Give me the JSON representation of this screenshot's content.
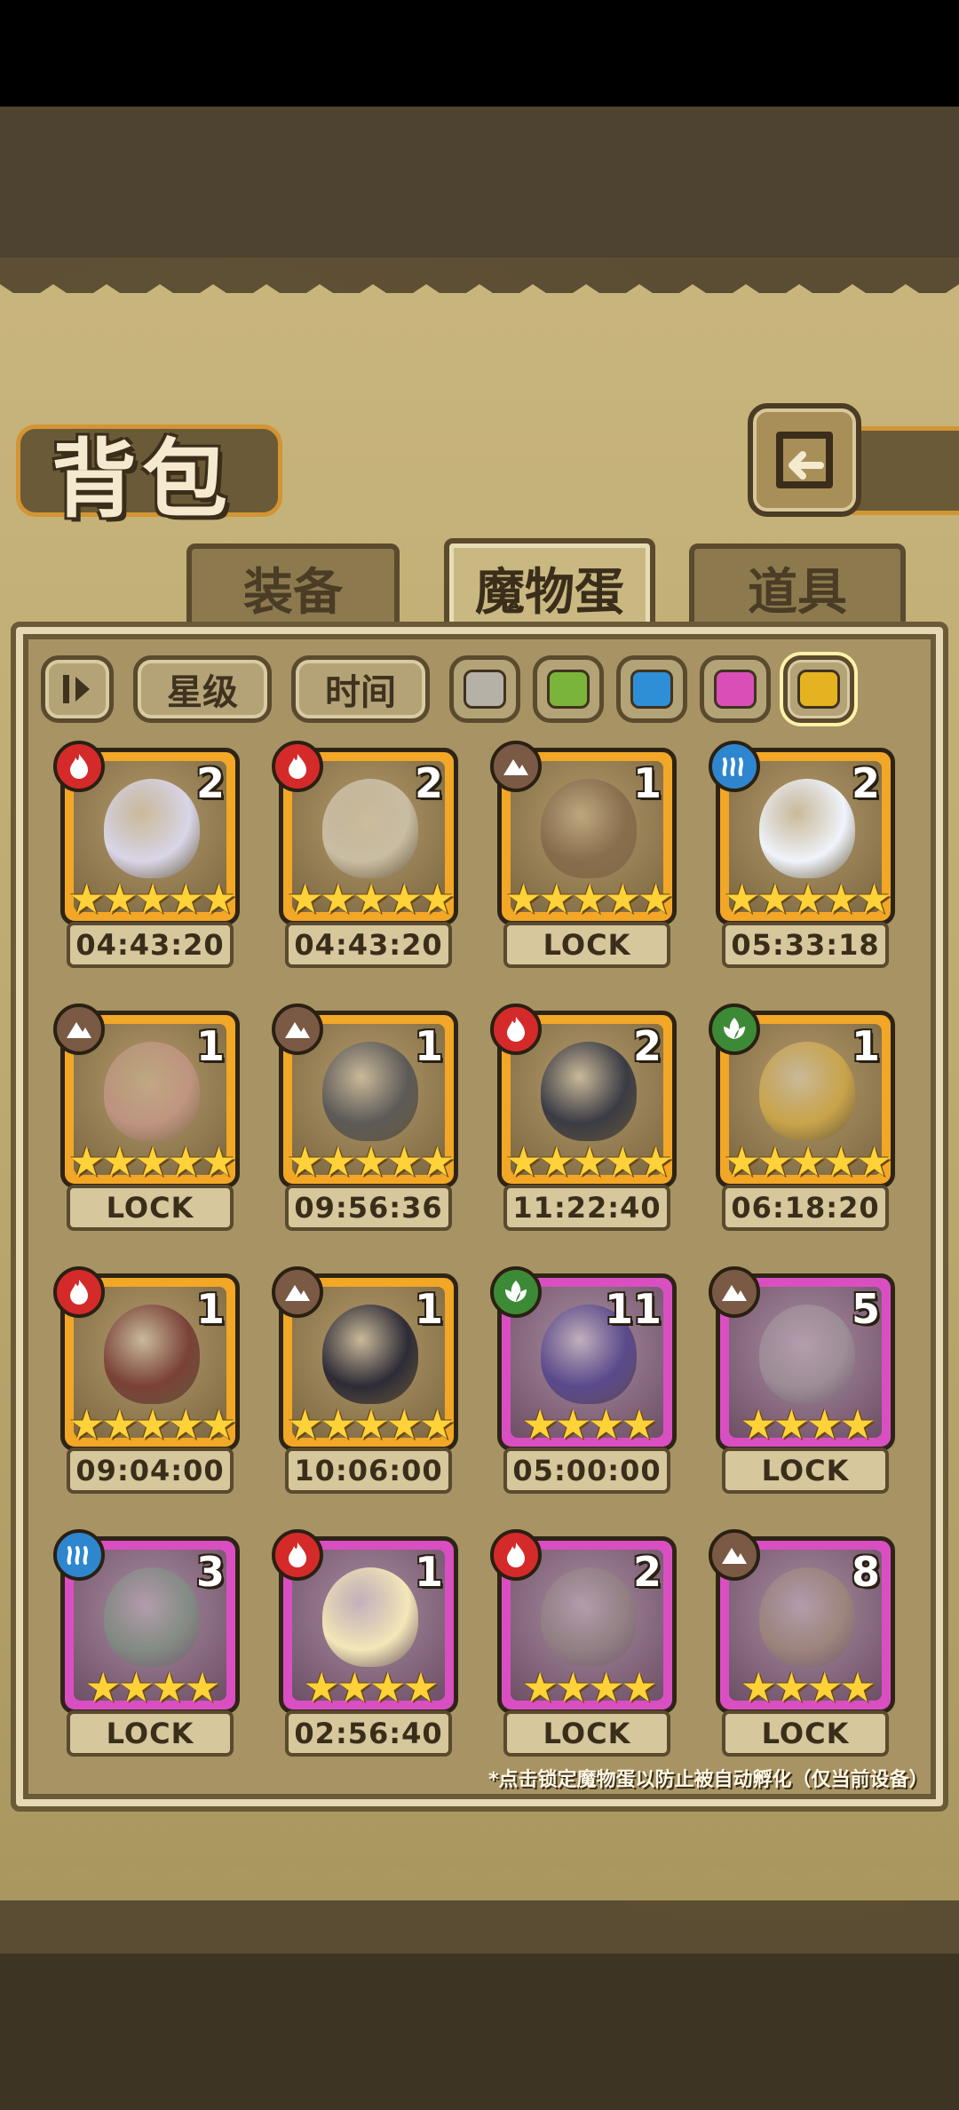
{
  "header": {
    "title": "背包",
    "back_icon": "back-arrow-icon"
  },
  "tabs": [
    {
      "label": "装备",
      "active": false
    },
    {
      "label": "魔物蛋",
      "active": true
    },
    {
      "label": "道具",
      "active": false
    }
  ],
  "filters": {
    "sort_icon": "sort-toggle-icon",
    "star_label": "星级",
    "time_label": "时间",
    "rarity_swatches": [
      {
        "name": "gray",
        "color": "#b5b1a6",
        "selected": false
      },
      {
        "name": "green",
        "color": "#7bb43a",
        "selected": false
      },
      {
        "name": "blue",
        "color": "#2f8fd6",
        "selected": false
      },
      {
        "name": "pink",
        "color": "#d94fb7",
        "selected": false
      },
      {
        "name": "gold",
        "color": "#e5b321",
        "selected": true
      }
    ]
  },
  "eggs": [
    {
      "element": "fire",
      "count": "2",
      "stars": 5,
      "timer": "04:43:20",
      "frame": "gold",
      "tint": "#d9d6e8"
    },
    {
      "element": "fire",
      "count": "2",
      "stars": 5,
      "timer": "04:43:20",
      "frame": "gold",
      "tint": "#c9bda3"
    },
    {
      "element": "earth",
      "count": "1",
      "stars": 5,
      "timer": "LOCK",
      "frame": "gold",
      "tint": "#6b4b3a"
    },
    {
      "element": "water",
      "count": "2",
      "stars": 5,
      "timer": "05:33:18",
      "frame": "gold",
      "tint": "#f0f4fb"
    },
    {
      "element": "earth",
      "count": "1",
      "stars": 5,
      "timer": "LOCK",
      "frame": "gold",
      "tint": "#e5a3ae"
    },
    {
      "element": "earth",
      "count": "1",
      "stars": 5,
      "timer": "09:56:36",
      "frame": "gold",
      "tint": "#5c5a58"
    },
    {
      "element": "fire",
      "count": "2",
      "stars": 5,
      "timer": "11:22:40",
      "frame": "gold",
      "tint": "#3a3b44"
    },
    {
      "element": "nature",
      "count": "1",
      "stars": 5,
      "timer": "06:18:20",
      "frame": "gold",
      "tint": "#c9a44a"
    },
    {
      "element": "fire",
      "count": "1",
      "stars": 5,
      "timer": "09:04:00",
      "frame": "gold",
      "tint": "#7a4138"
    },
    {
      "element": "earth",
      "count": "1",
      "stars": 5,
      "timer": "10:06:00",
      "frame": "gold",
      "tint": "#2d2b36"
    },
    {
      "element": "nature",
      "count": "11",
      "stars": 4,
      "timer": "05:00:00",
      "frame": "pink",
      "tint": "#5a4a8c"
    },
    {
      "element": "earth",
      "count": "5",
      "stars": 4,
      "timer": "LOCK",
      "frame": "pink",
      "tint": "#a8a8a4"
    },
    {
      "element": "water",
      "count": "3",
      "stars": 4,
      "timer": "LOCK",
      "frame": "pink",
      "tint": "#6ea47a"
    },
    {
      "element": "fire",
      "count": "1",
      "stars": 4,
      "timer": "02:56:40",
      "frame": "pink",
      "tint": "#f4e7b8"
    },
    {
      "element": "fire",
      "count": "2",
      "stars": 4,
      "timer": "LOCK",
      "frame": "pink",
      "tint": "#8f8a7a"
    },
    {
      "element": "earth",
      "count": "8",
      "stars": 4,
      "timer": "LOCK",
      "frame": "pink",
      "tint": "#a8946a"
    }
  ],
  "element_colors": {
    "fire": "#d52a2a",
    "earth": "#7a5a44",
    "water": "#2e86cf",
    "nature": "#3d8a36"
  },
  "footnote": "*点击锁定魔物蛋以防止被自动孵化（仅当前设备）"
}
